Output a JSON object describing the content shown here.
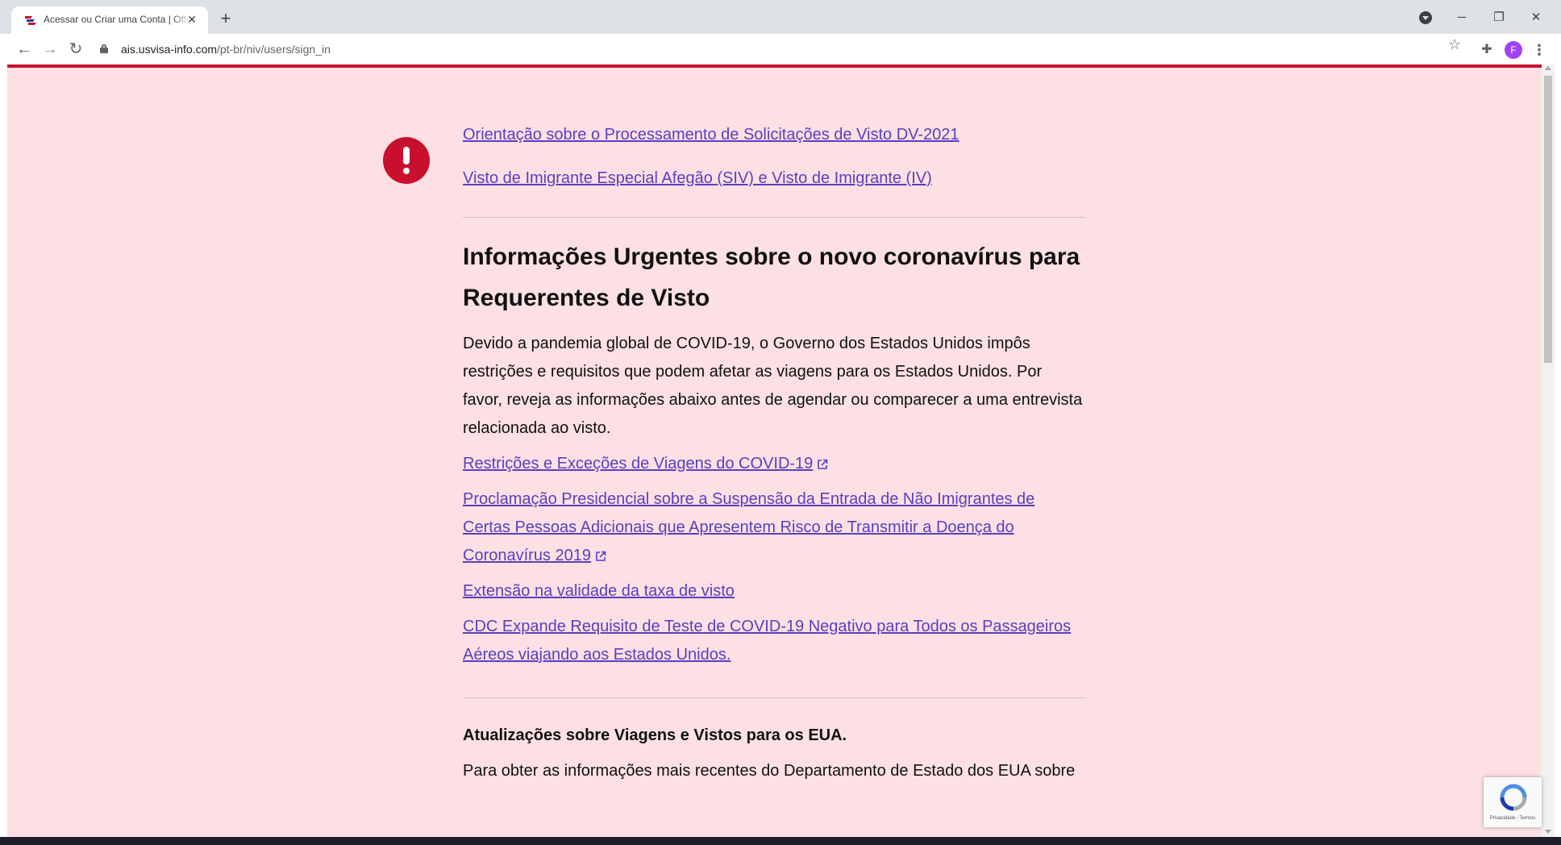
{
  "browser": {
    "tab_title": "Acessar ou Criar uma Conta | Official U.S. Department of State Visa Appointment Service",
    "new_tab_label": "+",
    "url_domain": "ais.usvisa-info.com",
    "url_path": "/pt-br/niv/users/sign_in",
    "profile_initial": "F",
    "icons": [
      "back-arrow-icon",
      "forward-arrow-icon",
      "reload-icon",
      "lock-icon",
      "star-icon",
      "extensions-puzzle-icon",
      "kebab-menu-icon",
      "tab-search-icon",
      "minimize-icon",
      "restore-icon",
      "close-icon"
    ]
  },
  "page": {
    "top_links": [
      "Orientação sobre o Processamento de Solicitações de Visto DV-2021",
      "Visto de Imigrante Especial Afegão (SIV) e Visto de Imigrante (IV)"
    ],
    "urgent": {
      "heading": "Informações Urgentes sobre o novo coronavírus para Requerentes de Visto",
      "body": "Devido a pandemia global de COVID-19, o Governo dos Estados Unidos impôs restrições e requisitos que podem afetar as viagens para os Estados Unidos. Por favor, reveja as informações abaixo antes de agendar ou comparecer a uma entrevista relacionada ao visto.",
      "links": {
        "restrictions": "Restrições e Exceções de Viagens do COVID-19",
        "proclamation": "Proclamação Presidencial sobre a Suspensão da Entrada de Não Imigrantes de Certas Pessoas Adicionais que Apresentem Risco de Transmitir a Doença do Coronavírus 2019",
        "fee_extension": "Extensão na validade da taxa de visto",
        "cdc": "CDC Expande Requisito de Teste de COVID-19 Negativo para Todos os Passageiros Aéreos viajando aos Estados Unidos."
      }
    },
    "updates": {
      "heading": "Atualizações sobre Viagens e Vistos para os EUA.",
      "body": "Para obter as informações mais recentes do Departamento de Estado dos EUA sobre"
    },
    "recaptcha_footer": "Privacidade - Termos"
  },
  "colors": {
    "page_background": "#fde0e3",
    "accent_red": "#c8102e",
    "link": "#5a3fc0"
  }
}
